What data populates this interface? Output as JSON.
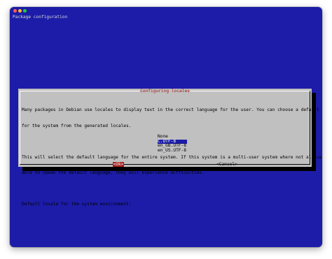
{
  "window": {
    "title": "Package configuration",
    "background_color": "#1c1ca8"
  },
  "dialog": {
    "title": "Configuring locales",
    "body_lines": [
      "Many packages in Debian use locales to display text in the correct language for the user. You can choose a default locale",
      "for the system from the generated locales.",
      "",
      "This will select the default language for the entire system. If this system is a multi-user system where not all users are",
      "able to speak the default language, they will experience difficulties.",
      "",
      "Default locale for the system environment:"
    ],
    "options": [
      "None",
      "C.UTF-8",
      "en_GB.UTF-8",
      "en_US.UTF-8"
    ],
    "selected_option": "C.UTF-8",
    "ok_label": "<Ok>",
    "cancel_label": "<Cancel>",
    "selection_color": "#1c1ca8",
    "accent_color": "#a41c1c"
  }
}
